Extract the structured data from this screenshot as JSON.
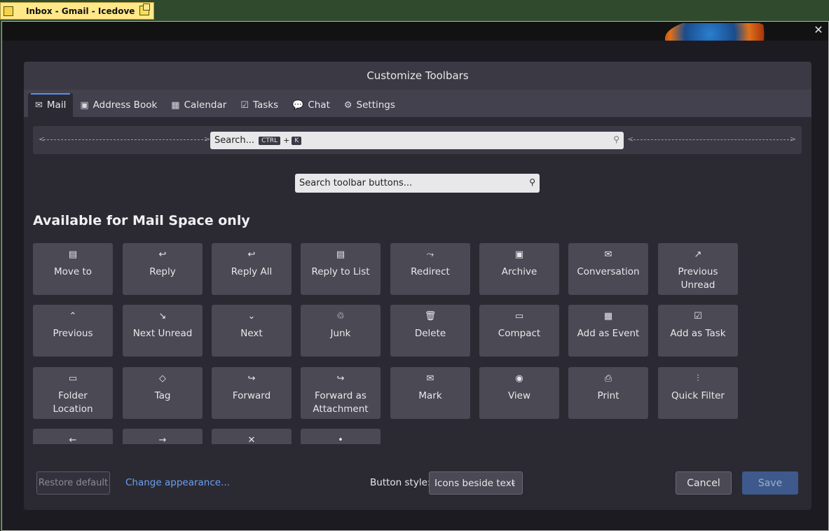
{
  "taskbar": {
    "window_title": "Inbox - Gmail - Icedove"
  },
  "dialog": {
    "title": "Customize Toolbars",
    "tabs": [
      {
        "label": "Mail",
        "icon": "mail-icon",
        "glyph": "✉",
        "active": true
      },
      {
        "label": "Address Book",
        "icon": "address-book-icon",
        "glyph": "▣",
        "active": false
      },
      {
        "label": "Calendar",
        "icon": "calendar-icon",
        "glyph": "▦",
        "active": false
      },
      {
        "label": "Tasks",
        "icon": "tasks-icon",
        "glyph": "☑",
        "active": false
      },
      {
        "label": "Chat",
        "icon": "chat-icon",
        "glyph": "💬",
        "active": false
      },
      {
        "label": "Settings",
        "icon": "settings-icon",
        "glyph": "⚙",
        "active": false
      }
    ],
    "toolbar_preview": {
      "search_label": "Search...",
      "shortcut_key1": "CTRL",
      "shortcut_plus": "+",
      "shortcut_key2": "K"
    },
    "search_buttons_placeholder": "Search toolbar buttons...",
    "section_title": "Available for Mail Space only",
    "buttons": [
      {
        "label": "Move to",
        "glyph": "▤",
        "icon": "move-to-icon"
      },
      {
        "label": "Reply",
        "glyph": "↩",
        "icon": "reply-icon"
      },
      {
        "label": "Reply All",
        "glyph": "↩",
        "icon": "reply-all-icon"
      },
      {
        "label": "Reply to List",
        "glyph": "▤",
        "icon": "reply-list-icon"
      },
      {
        "label": "Redirect",
        "glyph": "⤳",
        "icon": "redirect-icon"
      },
      {
        "label": "Archive",
        "glyph": "▣",
        "icon": "archive-icon"
      },
      {
        "label": "Conversation",
        "glyph": "✉",
        "icon": "conversation-icon"
      },
      {
        "label": "Previous\nUnread",
        "glyph": "↗",
        "icon": "previous-unread-icon"
      },
      {
        "label": "Previous",
        "glyph": "⌃",
        "icon": "previous-icon"
      },
      {
        "label": "Next Unread",
        "glyph": "↘",
        "icon": "next-unread-icon"
      },
      {
        "label": "Next",
        "glyph": "⌄",
        "icon": "next-icon"
      },
      {
        "label": "Junk",
        "glyph": "♲",
        "icon": "junk-icon"
      },
      {
        "label": "Delete",
        "glyph": "🗑",
        "icon": "delete-icon"
      },
      {
        "label": "Compact",
        "glyph": "▭",
        "icon": "compact-icon"
      },
      {
        "label": "Add as Event",
        "glyph": "▦",
        "icon": "add-event-icon"
      },
      {
        "label": "Add as Task",
        "glyph": "☑",
        "icon": "add-task-icon"
      },
      {
        "label": "Folder\nLocation",
        "glyph": "▭",
        "icon": "folder-location-icon"
      },
      {
        "label": "Tag",
        "glyph": "◇",
        "icon": "tag-icon"
      },
      {
        "label": "Forward",
        "glyph": "↪",
        "icon": "forward-icon"
      },
      {
        "label": "Forward as\nAttachment",
        "glyph": "↪",
        "icon": "forward-attachment-icon"
      },
      {
        "label": "Mark",
        "glyph": "✉",
        "icon": "mark-icon"
      },
      {
        "label": "View",
        "glyph": "◉",
        "icon": "view-icon"
      },
      {
        "label": "Print",
        "glyph": "⎙",
        "icon": "print-icon"
      },
      {
        "label": "Quick Filter",
        "glyph": "⫶",
        "icon": "quick-filter-icon"
      },
      {
        "label": "",
        "glyph": "←",
        "icon": "back-icon"
      },
      {
        "label": "",
        "glyph": "→",
        "icon": "forward-nav-icon"
      },
      {
        "label": "",
        "glyph": "✕",
        "icon": "stop-icon"
      },
      {
        "label": "",
        "glyph": "•",
        "icon": "separator-icon"
      }
    ],
    "footer": {
      "restore_label": "Restore default",
      "change_appearance_label": "Change appearance...",
      "button_style_label": "Button style:",
      "button_style_value": "Icons beside text",
      "cancel_label": "Cancel",
      "save_label": "Save"
    }
  },
  "colors": {
    "accent": "#5a8fe6",
    "link": "#6ba0f0",
    "dialog_bg": "#2b2a33",
    "button_bg": "#4a4954",
    "save_bg": "#3e5a8c"
  }
}
